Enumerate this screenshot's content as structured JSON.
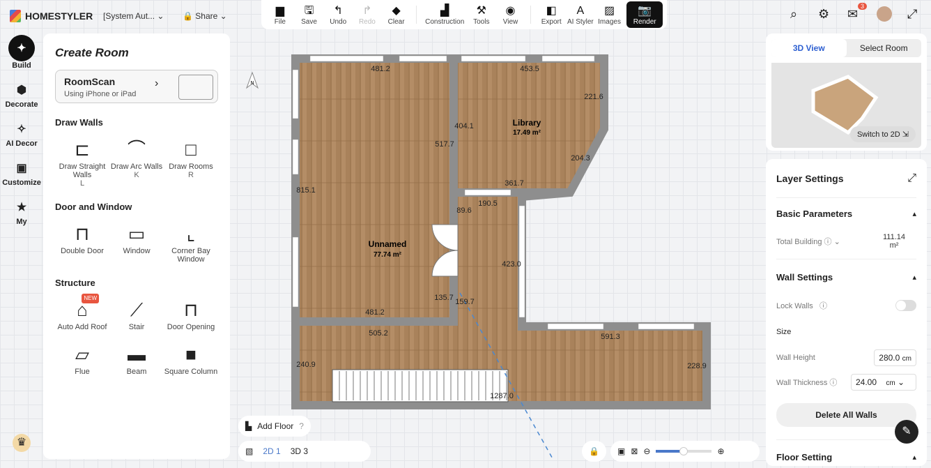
{
  "app": {
    "name": "HOMESTYLER",
    "project": "[System Aut...",
    "share": "Share"
  },
  "toolbar": [
    {
      "icon": "folder-icon",
      "glyph": "▆",
      "label": "File"
    },
    {
      "icon": "save-icon",
      "glyph": "🖫",
      "label": "Save"
    },
    {
      "icon": "undo-icon",
      "glyph": "↰",
      "label": "Undo"
    },
    {
      "icon": "redo-icon",
      "glyph": "↱",
      "label": "Redo",
      "disabled": true
    },
    {
      "icon": "eraser-icon",
      "glyph": "◆",
      "label": "Clear"
    },
    {
      "icon": "construction-icon",
      "glyph": "▟",
      "label": "Construction"
    },
    {
      "icon": "tools-icon",
      "glyph": "⚒",
      "label": "Tools"
    },
    {
      "icon": "eye-icon",
      "glyph": "◉",
      "label": "View"
    },
    {
      "icon": "export-icon",
      "glyph": "◧",
      "label": "Export"
    },
    {
      "icon": "ai-styler-icon",
      "glyph": "A",
      "label": "AI Styler"
    },
    {
      "icon": "images-icon",
      "glyph": "▨",
      "label": "Images"
    },
    {
      "icon": "camera-icon",
      "glyph": "📷",
      "label": "Render"
    }
  ],
  "topright": {
    "messages_count": "3"
  },
  "rail": [
    {
      "label": "Build",
      "glyph": "✦"
    },
    {
      "label": "Decorate",
      "glyph": "⬢"
    },
    {
      "label": "AI Decor",
      "glyph": "✧"
    },
    {
      "label": "Customize",
      "glyph": "▣"
    },
    {
      "label": "My",
      "glyph": "★"
    }
  ],
  "panel": {
    "title": "Create Room",
    "roomscan": {
      "title": "RoomScan",
      "subtitle": "Using iPhone or iPad"
    },
    "sections": [
      {
        "title": "Draw Walls",
        "items": [
          {
            "label": "Draw Straight Walls",
            "key": "L",
            "glyph": "⊏"
          },
          {
            "label": "Draw Arc Walls",
            "key": "K",
            "glyph": "⌒"
          },
          {
            "label": "Draw Rooms",
            "key": "R",
            "glyph": "□"
          }
        ]
      },
      {
        "title": "Door and Window",
        "items": [
          {
            "label": "Double Door",
            "glyph": "⊓"
          },
          {
            "label": "Window",
            "glyph": "▭"
          },
          {
            "label": "Corner Bay Window",
            "glyph": "⌞"
          }
        ]
      },
      {
        "title": "Structure",
        "items": [
          {
            "label": "Auto Add Roof",
            "glyph": "⌂",
            "badge": "NEW"
          },
          {
            "label": "Stair",
            "glyph": "⟋"
          },
          {
            "label": "Door Opening",
            "glyph": "⊓"
          },
          {
            "label": "Flue",
            "glyph": "▱"
          },
          {
            "label": "Beam",
            "glyph": "▬"
          },
          {
            "label": "Square Column",
            "glyph": "■"
          }
        ]
      }
    ]
  },
  "plan": {
    "rooms": [
      {
        "name": "Unnamed",
        "area": "77.74 m²"
      },
      {
        "name": "Library",
        "area": "17.49 m²"
      }
    ],
    "dims": [
      "481.2",
      "453.5",
      "221.6",
      "404.1",
      "517.7",
      "204.3",
      "815.1",
      "361.7",
      "190.5",
      "89.6",
      "423.0",
      "481.2",
      "135.7",
      "159.7",
      "505.2",
      "591.3",
      "240.9",
      "228.9",
      "1287.0"
    ],
    "north": "N"
  },
  "preview": {
    "tab_active": "3D View",
    "tab_other": "Select Room",
    "switch": "Switch to 2D"
  },
  "layer": {
    "title": "Layer Settings",
    "basic": "Basic Parameters",
    "total_label": "Total Building",
    "total_value": "111.14",
    "total_unit": "m²",
    "wall": "Wall Settings",
    "lock": "Lock Walls",
    "size": "Size",
    "height_label": "Wall Height",
    "height": "280.0",
    "height_unit": "cm",
    "thick_label": "Wall Thickness",
    "thick": "24.00",
    "thick_unit": "cm",
    "delete": "Delete All Walls",
    "floor": "Floor Setting"
  },
  "bottom": {
    "add_floor": "Add Floor",
    "view2d": "2D 1",
    "view3d": "3D 3",
    "zoom_fraction": 0.5
  }
}
